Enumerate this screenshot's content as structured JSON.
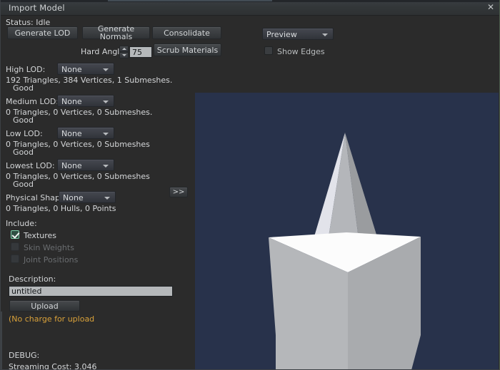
{
  "window": {
    "title": "Import Model",
    "close_icon": "close-icon"
  },
  "status": {
    "label": "Status: Idle"
  },
  "actions": {
    "generate_lod": "Generate LOD",
    "generate_normals": "Generate Normals",
    "consolidate": "Consolidate",
    "scrub_materials": "Scrub Materials"
  },
  "hard_angle": {
    "label": "Hard Angle",
    "value": "75"
  },
  "preview_controls": {
    "mode": "Preview",
    "show_edges_label": "Show Edges",
    "show_edges_checked": false
  },
  "lods": [
    {
      "label": "High LOD:",
      "value": "None",
      "stats": "192 Triangles, 384 Vertices, 1 Submeshes.",
      "quality": "Good"
    },
    {
      "label": "Medium LOD:",
      "value": "None",
      "stats": "0 Triangles, 0 Vertices, 0 Submeshes.",
      "quality": "Good"
    },
    {
      "label": "Low LOD:",
      "value": "None",
      "stats": "0 Triangles, 0 Vertices, 0 Submeshes",
      "quality": "Good"
    },
    {
      "label": "Lowest LOD:",
      "value": "None",
      "stats": "0 Triangles, 0 Vertices, 0 Submeshes",
      "quality": "Good"
    }
  ],
  "physical_shape": {
    "label": "Physical Shape:",
    "value": "None",
    "stats": "0 Triangles, 0 Hulls, 0 Points",
    "expand_label": ">>"
  },
  "include": {
    "heading": "Include:",
    "items": [
      {
        "label": "Textures",
        "checked": true,
        "enabled": true
      },
      {
        "label": "Skin Weights",
        "checked": false,
        "enabled": false
      },
      {
        "label": "Joint Positions",
        "checked": false,
        "enabled": false
      }
    ]
  },
  "description": {
    "label": "Description:",
    "value": "untitled"
  },
  "upload": {
    "button_label": "Upload",
    "note": "(No charge for upload"
  },
  "debug": {
    "heading": "DEBUG:",
    "streaming_cost": "Streaming Cost: 3.046"
  },
  "colors": {
    "panel_bg": "#2b2b2b",
    "titlebar": "#33373a",
    "preview_bg": "#28324b",
    "warn_text": "#d8a13a",
    "check_accent": "#7fd0ab",
    "input_bg": "#b5b8ba"
  }
}
